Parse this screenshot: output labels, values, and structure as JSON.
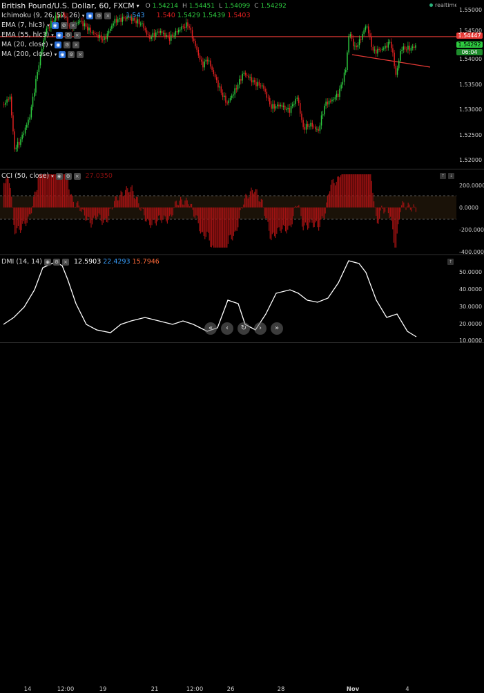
{
  "header": {
    "symbol": "British Pound/U.S. Dollar, 60, FXCM",
    "ohlc": [
      {
        "key": "O",
        "value": "1.54214"
      },
      {
        "key": "H",
        "value": "1.54451"
      },
      {
        "key": "L",
        "value": "1.54099"
      },
      {
        "key": "C",
        "value": "1.54292"
      }
    ],
    "realtime": "realtime"
  },
  "legend": {
    "ichimoku": {
      "label": "Ichimoku (9, 26, 52, 26)",
      "values": [
        "1.543",
        "1.540",
        "1.5429",
        "1.5439",
        "1.5403"
      ]
    },
    "ema7": "EMA (7, hlc3)",
    "ema55": "EMA (55, hlc3)",
    "ma20": "MA (20, close)",
    "ma200": "MA (200, close)"
  },
  "price_axis": [
    "1.55000",
    "1.54500",
    "1.54000",
    "1.53500",
    "1.53000",
    "1.52500",
    "1.52000"
  ],
  "price_tags": {
    "high_line": "1.54447",
    "last": "1.54292",
    "countdown": "06:04"
  },
  "cci": {
    "label": "CCI (50, close)",
    "value": "27.0350",
    "axis": [
      "200.0000",
      "0.0000",
      "-200.0000",
      "-400.0000"
    ]
  },
  "dmi": {
    "label": "DMI (14, 14)",
    "adx": "12.5903",
    "plus": "22.4293",
    "minus": "15.7946",
    "axis": [
      "50.0000",
      "40.0000",
      "30.0000",
      "20.0000",
      "10.0000"
    ]
  },
  "x_axis": [
    "14",
    "12:00",
    "19",
    "21",
    "12:00",
    "26",
    "28",
    "Nov",
    "4"
  ],
  "colors": {
    "up": "#2ecc40",
    "down": "#e02020",
    "line_red": "#e53935",
    "dmi_line": "#ffffff",
    "cci_bar": "#a11212",
    "adx": "#ffffff",
    "plus_di": "#3aa0ff",
    "minus_di": "#ff6a3a"
  },
  "nav_icons": [
    "arrow-left-icon",
    "arrow-left-icon",
    "reset-icon",
    "arrow-right-icon",
    "arrow-right-icon"
  ]
}
